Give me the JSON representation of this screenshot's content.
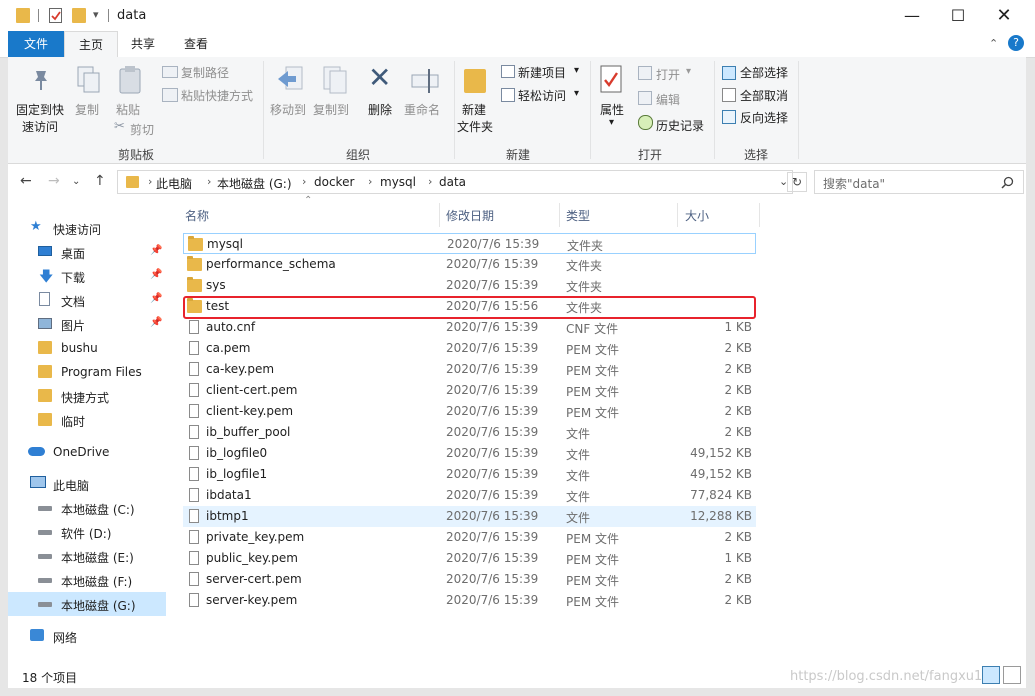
{
  "window": {
    "title": "data"
  },
  "tabs": {
    "file": "文件",
    "home": "主页",
    "share": "共享",
    "view": "查看"
  },
  "ribbon": {
    "clipboard": {
      "pin": "固定到快\n速访问",
      "pin_l1": "固定到快",
      "pin_l2": "速访问",
      "copy": "复制",
      "paste": "粘贴",
      "copy_path": "复制路径",
      "paste_shortcut": "粘贴快捷方式",
      "cut": "剪切",
      "label": "剪贴板"
    },
    "organize": {
      "move_to": "移动到",
      "copy_to": "复制到",
      "delete": "删除",
      "rename": "重命名",
      "label": "组织"
    },
    "new": {
      "new_folder_l1": "新建",
      "new_folder_l2": "文件夹",
      "new_item": "新建项目",
      "easy_access": "轻松访问",
      "label": "新建"
    },
    "open": {
      "properties": "属性",
      "open": "打开",
      "edit": "编辑",
      "history": "历史记录",
      "label": "打开"
    },
    "select": {
      "select_all": "全部选择",
      "select_none": "全部取消",
      "invert": "反向选择",
      "label": "选择"
    }
  },
  "address": {
    "crumbs": [
      "此电脑",
      "本地磁盘 (G:)",
      "docker",
      "mysql",
      "data"
    ],
    "search_placeholder": "搜索\"data\""
  },
  "sidebar": [
    {
      "label": "快速访问",
      "icon": "star-icon"
    },
    {
      "label": "桌面",
      "icon": "desktop-icon",
      "pinned": true
    },
    {
      "label": "下载",
      "icon": "download-icon",
      "pinned": true
    },
    {
      "label": "文档",
      "icon": "document-icon",
      "pinned": true
    },
    {
      "label": "图片",
      "icon": "picture-icon",
      "pinned": true
    },
    {
      "label": "bushu",
      "icon": "folder-icon"
    },
    {
      "label": "Program Files",
      "icon": "folder-icon"
    },
    {
      "label": "快捷方式",
      "icon": "folder-icon"
    },
    {
      "label": "临时",
      "icon": "folder-icon"
    },
    {
      "label": "OneDrive",
      "icon": "cloud-icon"
    },
    {
      "label": "此电脑",
      "icon": "computer-icon"
    },
    {
      "label": "本地磁盘 (C:)",
      "icon": "drive-icon"
    },
    {
      "label": "软件 (D:)",
      "icon": "drive-icon"
    },
    {
      "label": "本地磁盘 (E:)",
      "icon": "drive-icon"
    },
    {
      "label": "本地磁盘 (F:)",
      "icon": "drive-icon"
    },
    {
      "label": "本地磁盘 (G:)",
      "icon": "drive-icon",
      "selected": true
    },
    {
      "label": "网络",
      "icon": "network-icon"
    }
  ],
  "columns": {
    "name": "名称",
    "date": "修改日期",
    "type": "类型",
    "size": "大小"
  },
  "files": [
    {
      "name": "mysql",
      "date": "2020/7/6 15:39",
      "type": "文件夹",
      "size": "",
      "kind": "folder"
    },
    {
      "name": "performance_schema",
      "date": "2020/7/6 15:39",
      "type": "文件夹",
      "size": "",
      "kind": "folder"
    },
    {
      "name": "sys",
      "date": "2020/7/6 15:39",
      "type": "文件夹",
      "size": "",
      "kind": "folder"
    },
    {
      "name": "test",
      "date": "2020/7/6 15:56",
      "type": "文件夹",
      "size": "",
      "kind": "folder"
    },
    {
      "name": "auto.cnf",
      "date": "2020/7/6 15:39",
      "type": "CNF 文件",
      "size": "1 KB",
      "kind": "file"
    },
    {
      "name": "ca.pem",
      "date": "2020/7/6 15:39",
      "type": "PEM 文件",
      "size": "2 KB",
      "kind": "file"
    },
    {
      "name": "ca-key.pem",
      "date": "2020/7/6 15:39",
      "type": "PEM 文件",
      "size": "2 KB",
      "kind": "file"
    },
    {
      "name": "client-cert.pem",
      "date": "2020/7/6 15:39",
      "type": "PEM 文件",
      "size": "2 KB",
      "kind": "file"
    },
    {
      "name": "client-key.pem",
      "date": "2020/7/6 15:39",
      "type": "PEM 文件",
      "size": "2 KB",
      "kind": "file"
    },
    {
      "name": "ib_buffer_pool",
      "date": "2020/7/6 15:39",
      "type": "文件",
      "size": "2 KB",
      "kind": "file"
    },
    {
      "name": "ib_logfile0",
      "date": "2020/7/6 15:39",
      "type": "文件",
      "size": "49,152 KB",
      "kind": "file"
    },
    {
      "name": "ib_logfile1",
      "date": "2020/7/6 15:39",
      "type": "文件",
      "size": "49,152 KB",
      "kind": "file"
    },
    {
      "name": "ibdata1",
      "date": "2020/7/6 15:39",
      "type": "文件",
      "size": "77,824 KB",
      "kind": "file"
    },
    {
      "name": "ibtmp1",
      "date": "2020/7/6 15:39",
      "type": "文件",
      "size": "12,288 KB",
      "kind": "file",
      "hover": true
    },
    {
      "name": "private_key.pem",
      "date": "2020/7/6 15:39",
      "type": "PEM 文件",
      "size": "2 KB",
      "kind": "file"
    },
    {
      "name": "public_key.pem",
      "date": "2020/7/6 15:39",
      "type": "PEM 文件",
      "size": "1 KB",
      "kind": "file"
    },
    {
      "name": "server-cert.pem",
      "date": "2020/7/6 15:39",
      "type": "PEM 文件",
      "size": "2 KB",
      "kind": "file"
    },
    {
      "name": "server-key.pem",
      "date": "2020/7/6 15:39",
      "type": "PEM 文件",
      "size": "2 KB",
      "kind": "file"
    }
  ],
  "status": {
    "count": "18 个项目",
    "watermark": "https://blog.csdn.net/fangxu1"
  },
  "colors": {
    "accent": "#1979ca",
    "folder": "#e9b84a",
    "highlight": "#e8232c",
    "selection": "#cce8ff"
  }
}
